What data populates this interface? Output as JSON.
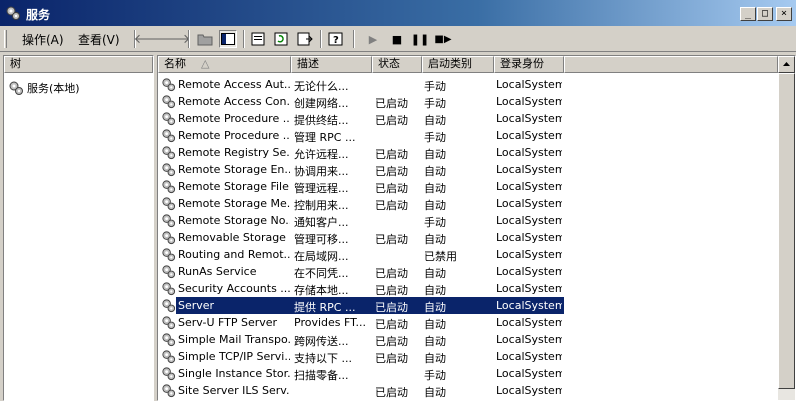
{
  "window": {
    "title": "服务",
    "min": "_",
    "max": "□",
    "close": "×"
  },
  "menu": {
    "action": "操作(A)",
    "view": "查看(V)"
  },
  "tree": {
    "header": "树",
    "item": "服务(本地)"
  },
  "columns": {
    "name": "名称",
    "desc": "描述",
    "status": "状态",
    "startup": "启动类别",
    "logon": "登录身份",
    "sort_indicator": "△"
  },
  "services": [
    {
      "name": "Remote Access Aut...",
      "desc": "无论什么...",
      "status": "",
      "startup": "手动",
      "logon": "LocalSystem"
    },
    {
      "name": "Remote Access Con...",
      "desc": "创建网络...",
      "status": "已启动",
      "startup": "手动",
      "logon": "LocalSystem"
    },
    {
      "name": "Remote Procedure ...",
      "desc": "提供终结...",
      "status": "已启动",
      "startup": "自动",
      "logon": "LocalSystem"
    },
    {
      "name": "Remote Procedure ...",
      "desc": "管理 RPC ...",
      "status": "",
      "startup": "手动",
      "logon": "LocalSystem"
    },
    {
      "name": "Remote Registry Se...",
      "desc": "允许远程...",
      "status": "已启动",
      "startup": "自动",
      "logon": "LocalSystem"
    },
    {
      "name": "Remote Storage En...",
      "desc": "协调用来...",
      "status": "已启动",
      "startup": "自动",
      "logon": "LocalSystem"
    },
    {
      "name": "Remote Storage File",
      "desc": "管理远程...",
      "status": "已启动",
      "startup": "自动",
      "logon": "LocalSystem"
    },
    {
      "name": "Remote Storage Me...",
      "desc": "控制用来...",
      "status": "已启动",
      "startup": "自动",
      "logon": "LocalSystem"
    },
    {
      "name": "Remote Storage No...",
      "desc": "通知客户...",
      "status": "",
      "startup": "手动",
      "logon": "LocalSystem"
    },
    {
      "name": "Removable Storage",
      "desc": "管理可移...",
      "status": "已启动",
      "startup": "自动",
      "logon": "LocalSystem"
    },
    {
      "name": "Routing and Remot...",
      "desc": "在局域网...",
      "status": "",
      "startup": "已禁用",
      "logon": "LocalSystem"
    },
    {
      "name": "RunAs Service",
      "desc": "在不同凭...",
      "status": "已启动",
      "startup": "自动",
      "logon": "LocalSystem"
    },
    {
      "name": "Security Accounts ...",
      "desc": "存储本地...",
      "status": "已启动",
      "startup": "自动",
      "logon": "LocalSystem"
    },
    {
      "name": "Server",
      "desc": "提供 RPC ...",
      "status": "已启动",
      "startup": "自动",
      "logon": "LocalSystem",
      "selected": true
    },
    {
      "name": "Serv-U FTP Server",
      "desc": "Provides FT...",
      "status": "已启动",
      "startup": "自动",
      "logon": "LocalSystem"
    },
    {
      "name": "Simple Mail Transpo...",
      "desc": "跨网传送...",
      "status": "已启动",
      "startup": "自动",
      "logon": "LocalSystem"
    },
    {
      "name": "Simple TCP/IP Servi...",
      "desc": "支持以下 ...",
      "status": "已启动",
      "startup": "自动",
      "logon": "LocalSystem"
    },
    {
      "name": "Single Instance Stor...",
      "desc": "扫描零备...",
      "status": "",
      "startup": "手动",
      "logon": "LocalSystem"
    },
    {
      "name": "Site Server ILS Serv...",
      "desc": "",
      "status": "已启动",
      "startup": "自动",
      "logon": "LocalSystem"
    }
  ],
  "colors": {
    "selection": "#0a246a",
    "titlebar": "#0a246a",
    "face": "#d4d0c8"
  }
}
